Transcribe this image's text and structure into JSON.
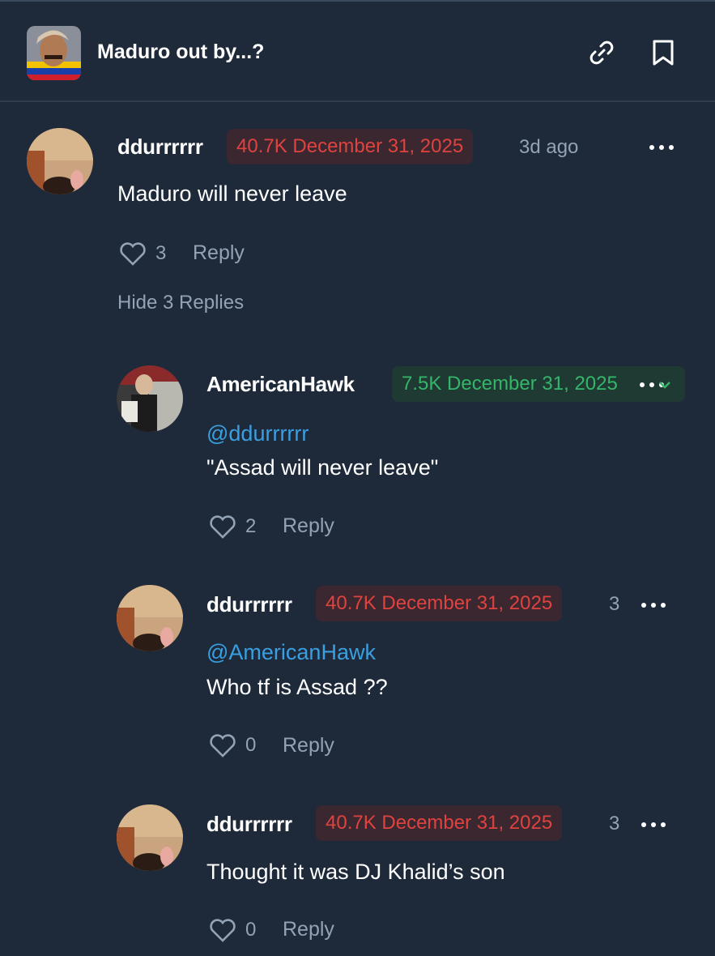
{
  "header": {
    "title": "Maduro out by...?",
    "link_icon": "link-icon",
    "bookmark_icon": "bookmark-icon"
  },
  "colors": {
    "background": "#1e2a3a",
    "badge_red_text": "#e0433f",
    "badge_green_text": "#35b56a",
    "mention": "#3a9fe0",
    "muted": "#93a2b5"
  },
  "comments": [
    {
      "user": "ddurrrrrr",
      "badge": "40.7K December 31, 2025",
      "time": "3d ago",
      "text": "Maduro will never leave",
      "likes": "3",
      "reply_label": "Reply",
      "hide_replies": "Hide 3 Replies"
    },
    {
      "user": "AmericanHawk",
      "badge": "7.5K December 31, 2025",
      "mention": "@ddurrrrrr",
      "text": "\"Assad will never leave\"",
      "likes": "2",
      "reply_label": "Reply"
    },
    {
      "user": "ddurrrrrr",
      "badge": "40.7K December 31, 2025",
      "time": "3",
      "mention": "@AmericanHawk",
      "text": "Who tf is Assad ??",
      "likes": "0",
      "reply_label": "Reply"
    },
    {
      "user": "ddurrrrrr",
      "badge": "40.7K December 31, 2025",
      "time": "3",
      "text": "Thought it was DJ Khalid’s son",
      "likes": "0",
      "reply_label": "Reply"
    }
  ]
}
